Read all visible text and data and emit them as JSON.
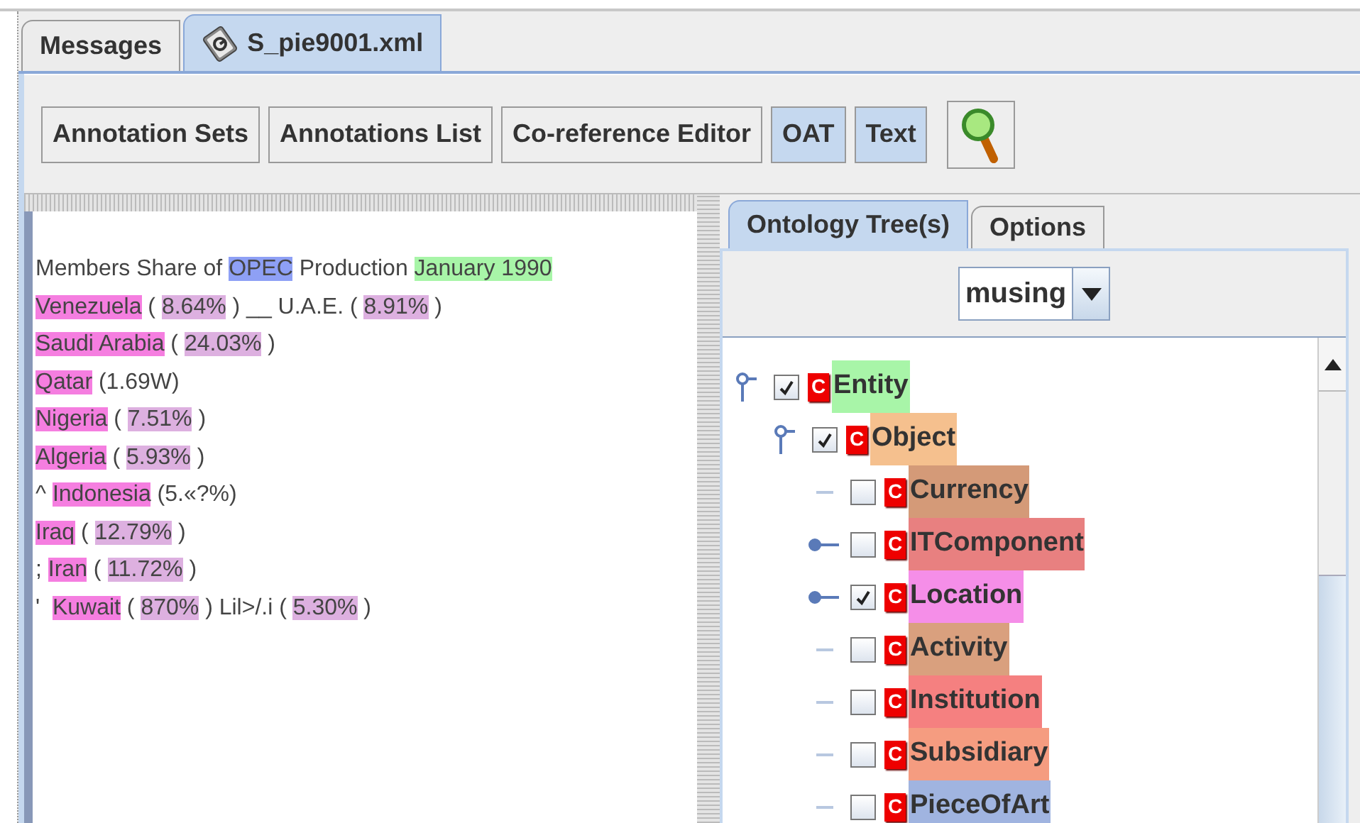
{
  "tabs": [
    {
      "label": "Messages",
      "selected": false,
      "icon": false
    },
    {
      "label": "S_pie9001.xml",
      "selected": true,
      "icon": true
    }
  ],
  "toolbar": [
    {
      "label": "Annotation Sets",
      "selected": false,
      "kind": "text"
    },
    {
      "label": "Annotations List",
      "selected": false,
      "kind": "text"
    },
    {
      "label": "Co-reference Editor",
      "selected": false,
      "kind": "text"
    },
    {
      "label": "OAT",
      "selected": true,
      "kind": "text"
    },
    {
      "label": "Text",
      "selected": true,
      "kind": "text"
    },
    {
      "kind": "search",
      "selected": false
    }
  ],
  "document": [
    [
      {
        "text": "Members Share of "
      },
      {
        "text": "OPEC",
        "color": "#8ea0f5"
      },
      {
        "text": " Production "
      },
      {
        "text": "January 1990",
        "color": "#a8f5a8"
      }
    ],
    [
      {
        "text": "Venezuela",
        "color": "#f57ee0"
      },
      {
        "text": " ( "
      },
      {
        "text": "8.64%",
        "color": "#ddb0e0"
      },
      {
        "text": " ) __ U.A.E. ( "
      },
      {
        "text": "8.91%",
        "color": "#ddb0e0"
      },
      {
        "text": " )"
      }
    ],
    [
      {
        "text": "Saudi Arabia",
        "color": "#f57ee0"
      },
      {
        "text": " ( "
      },
      {
        "text": "24.03%",
        "color": "#ddb0e0"
      },
      {
        "text": " )"
      }
    ],
    [
      {
        "text": "Qatar",
        "color": "#f57ee0"
      },
      {
        "text": " (1.69W)"
      }
    ],
    [
      {
        "text": "Nigeria",
        "color": "#f57ee0"
      },
      {
        "text": " ( "
      },
      {
        "text": "7.51%",
        "color": "#ddb0e0"
      },
      {
        "text": " )"
      }
    ],
    [
      {
        "text": "Algeria",
        "color": "#f57ee0"
      },
      {
        "text": " ( "
      },
      {
        "text": "5.93%",
        "color": "#ddb0e0"
      },
      {
        "text": " )"
      }
    ],
    [
      {
        "text": "^ "
      },
      {
        "text": "Indonesia",
        "color": "#f57ee0"
      },
      {
        "text": " (5.«?%)"
      }
    ],
    [
      {
        "text": "Iraq",
        "color": "#f57ee0"
      },
      {
        "text": " ( "
      },
      {
        "text": "12.79%",
        "color": "#ddb0e0"
      },
      {
        "text": " )"
      }
    ],
    [
      {
        "text": "; "
      },
      {
        "text": "Iran",
        "color": "#f57ee0"
      },
      {
        "text": " ( "
      },
      {
        "text": "11.72%",
        "color": "#ddb0e0"
      },
      {
        "text": " )"
      }
    ],
    [
      {
        "text": "'  "
      },
      {
        "text": "Kuwait",
        "color": "#f57ee0"
      },
      {
        "text": " ( "
      },
      {
        "text": "870%",
        "color": "#ddb0e0"
      },
      {
        "text": " ) Lil>/.i ( "
      },
      {
        "text": "5.30%",
        "color": "#ddb0e0"
      },
      {
        "text": " )"
      }
    ]
  ],
  "side_tabs": [
    {
      "label": "Ontology Tree(s)",
      "selected": true
    },
    {
      "label": "Options",
      "selected": false
    }
  ],
  "ontology_select": {
    "value": "musing"
  },
  "tree": [
    {
      "label": "Entity",
      "badge": "C",
      "checked": true,
      "kind": "folder",
      "expanded": true,
      "color": "#a8f5a8",
      "children": [
        {
          "label": "Object",
          "badge": "C",
          "checked": true,
          "kind": "folder",
          "expanded": true,
          "color": "#f5c08e",
          "children": [
            {
              "label": "Currency",
              "badge": "C",
              "checked": false,
              "kind": "leaf",
              "color": "#d49a78"
            },
            {
              "label": "ITComponent",
              "badge": "C",
              "checked": false,
              "kind": "folder",
              "expanded": false,
              "color": "#e88080"
            },
            {
              "label": "Location",
              "badge": "C",
              "checked": true,
              "kind": "folder",
              "expanded": false,
              "color": "#f58ee8"
            },
            {
              "label": "Activity",
              "badge": "C",
              "checked": false,
              "kind": "leaf",
              "color": "#d9a07e"
            },
            {
              "label": "Institution",
              "badge": "C",
              "checked": false,
              "kind": "leaf",
              "color": "#f58080"
            },
            {
              "label": "Subsidiary",
              "badge": "C",
              "checked": false,
              "kind": "leaf",
              "color": "#f59c80"
            },
            {
              "label": "PieceOfArt",
              "badge": "C",
              "checked": false,
              "kind": "leaf",
              "color": "#a0b4e0"
            }
          ]
        }
      ]
    }
  ]
}
